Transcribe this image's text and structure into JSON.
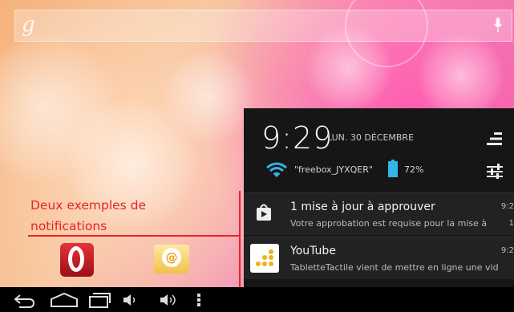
{
  "search": {
    "logo_glyph": "g"
  },
  "annotation": {
    "line1": "Deux exemples de",
    "line2": "notifications",
    "color": "#e5242a"
  },
  "apps": [
    {
      "name": "Opera"
    },
    {
      "name": "Email"
    }
  ],
  "status": {
    "time": "9:29",
    "date": "LUN. 30 DÉCEMBRE",
    "network": "\"freebox_JYXQER\"",
    "battery": "72%"
  },
  "notifications": [
    {
      "title": "1 mise à jour à approuver",
      "subtitle": "Votre approbation est requise pour la mise à",
      "time": "9:2",
      "right": "1",
      "icon": "play-store-icon"
    },
    {
      "title": "YouTube",
      "subtitle": "TabletteTactile vient de mettre en ligne une vid",
      "time": "9:2",
      "right": "",
      "icon": "youtube-app-icon"
    }
  ],
  "navbar": {
    "items": [
      "back-icon",
      "home-icon",
      "recents-icon",
      "volume-down-icon",
      "volume-up-icon",
      "menu-icon"
    ]
  }
}
